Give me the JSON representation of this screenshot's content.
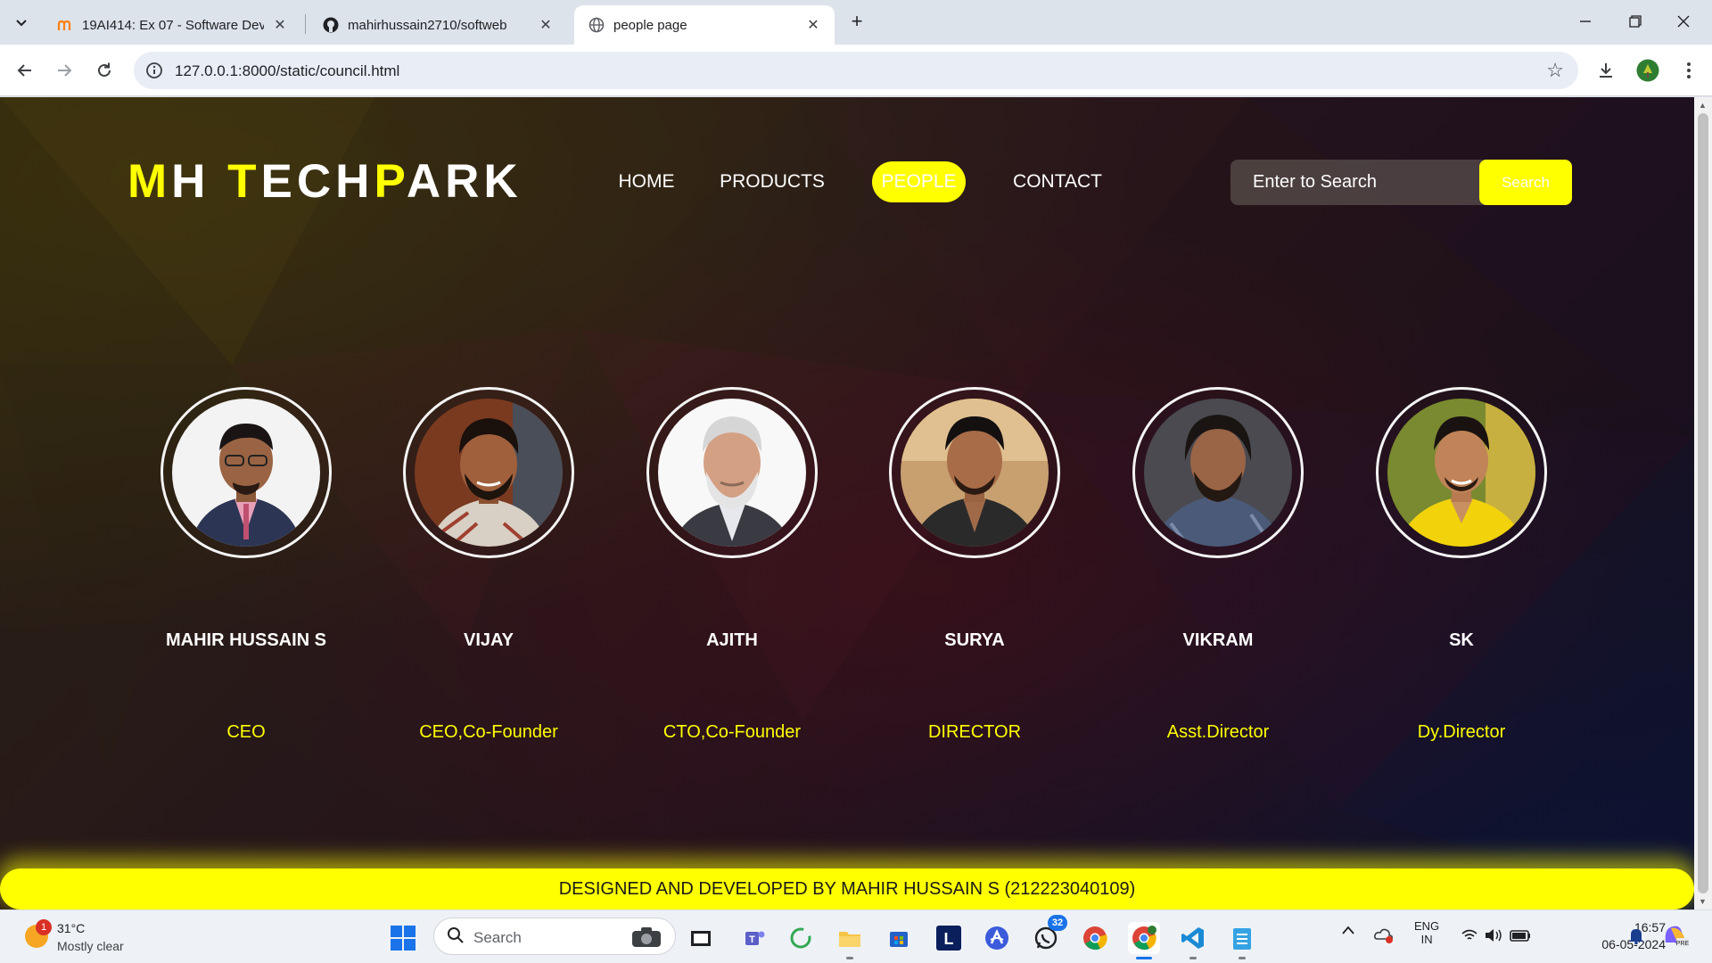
{
  "browser": {
    "tabs": [
      {
        "title": "19AI414: Ex 07 - Software Deve",
        "active": false
      },
      {
        "title": "mahirhussain2710/softweb",
        "active": false
      },
      {
        "title": "people page",
        "active": true
      }
    ],
    "url": "127.0.0.1:8000/static/council.html"
  },
  "page": {
    "logo": {
      "part1": "M",
      "part2": "H ",
      "part3": "T",
      "part4": "ECH",
      "part5": "P",
      "part6": "ARK"
    },
    "nav": [
      "HOME",
      "PRODUCTS",
      "PEOPLE",
      "CONTACT"
    ],
    "active_nav": "PEOPLE",
    "search": {
      "placeholder": "Enter to Search",
      "button": "Search"
    },
    "people": [
      {
        "name": "MAHIR HUSSAIN S",
        "role": "CEO"
      },
      {
        "name": "VIJAY",
        "role": "CEO,Co-Founder"
      },
      {
        "name": "AJITH",
        "role": "CTO,Co-Founder"
      },
      {
        "name": "SURYA",
        "role": "DIRECTOR"
      },
      {
        "name": "VIKRAM",
        "role": "Asst.Director"
      },
      {
        "name": "SK",
        "role": "Dy.Director"
      }
    ],
    "footer": "DESIGNED AND DEVELOPED BY MAHIR HUSSAIN S (212223040109)"
  },
  "colors": {
    "accent": "#ffff00",
    "text": "#ffffff"
  },
  "taskbar": {
    "weather": {
      "badge": "1",
      "temp": "31°C",
      "desc": "Mostly clear"
    },
    "search_label": "Search",
    "whatsapp_badge": "32",
    "lang": {
      "line1": "ENG",
      "line2": "IN"
    },
    "time": "16:57",
    "date": "06-05-2024"
  }
}
